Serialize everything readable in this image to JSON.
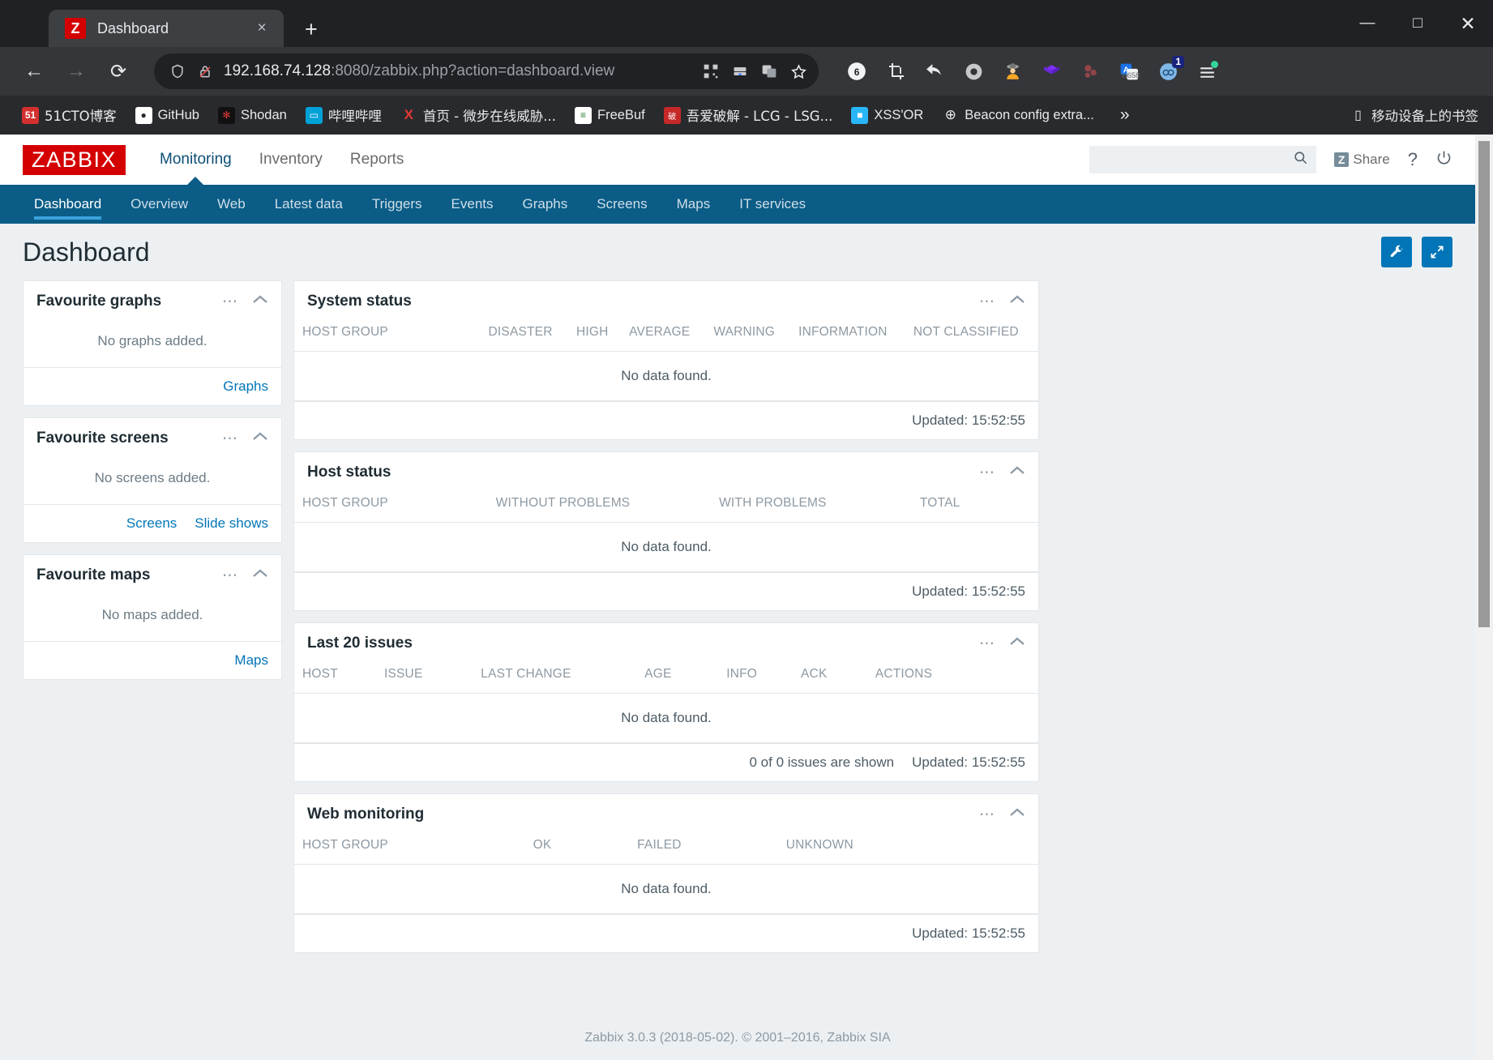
{
  "browser": {
    "tab": {
      "title": "Dashboard",
      "favicon_letter": "Z",
      "close_label": "×"
    },
    "new_tab_label": "+",
    "window_controls": {
      "minimize": "—",
      "maximize": "□",
      "close": "✕"
    },
    "nav": {
      "back": "←",
      "forward": "→",
      "reload": "⟳"
    },
    "omnibox": {
      "url_host": "192.168.74.128",
      "url_rest": ":8080/zabbix.php?action=dashboard.view",
      "shield_icon": "shield-icon",
      "lock_icon": "insecure-lock-icon",
      "qr_icon": "qr-code-icon",
      "device_icon": "save-to-device-icon",
      "translate_icon": "translate-icon",
      "bookmark_icon": "star-icon"
    },
    "extensions": [
      {
        "name": "counter-badge-icon",
        "glyph": "6"
      },
      {
        "name": "crop-capture-icon",
        "glyph": "⌧"
      },
      {
        "name": "undo-arrow-icon",
        "glyph": "↩"
      },
      {
        "name": "circle-ring-icon",
        "glyph": "◉"
      },
      {
        "name": "detective-icon",
        "glyph": "🕵"
      },
      {
        "name": "purple-cube-icon",
        "glyph": "⬟"
      },
      {
        "name": "red-dots-icon",
        "glyph": "⁙"
      },
      {
        "name": "translate-extension-icon",
        "glyph": "A"
      },
      {
        "name": "blue-badge-extension-icon",
        "glyph": "◑",
        "badge": "1"
      },
      {
        "name": "browser-menu-icon",
        "glyph": "≡"
      }
    ],
    "bookmarks": [
      {
        "label": "51CTO博客",
        "icon": "51cto-icon",
        "icon_text": "51",
        "icon_bg": "#d32f2f"
      },
      {
        "label": "GitHub",
        "icon": "github-icon",
        "icon_text": "●",
        "icon_bg": "#ffffff"
      },
      {
        "label": "Shodan",
        "icon": "shodan-icon",
        "icon_text": "⁙",
        "icon_bg": "#1a1a1a"
      },
      {
        "label": "哔哩哔哩",
        "icon": "bilibili-icon",
        "icon_text": "□",
        "icon_bg": "#00a1d6"
      },
      {
        "label": "首页 - 微步在线威胁...",
        "icon": "threatbook-icon",
        "icon_text": "X",
        "icon_bg": "transparent"
      },
      {
        "label": "FreeBuf",
        "icon": "freebuf-icon",
        "icon_text": "≡",
        "icon_bg": "#ffffff"
      },
      {
        "label": "吾爱破解 - LCG - LSG...",
        "icon": "52pojie-icon",
        "icon_text": "破",
        "icon_bg": "#c62828"
      },
      {
        "label": "XSS'OR",
        "icon": "xssor-icon",
        "icon_text": "■",
        "icon_bg": "#29b6f6"
      },
      {
        "label": "Beacon config extra...",
        "icon": "globe-icon",
        "icon_text": "⊕",
        "icon_bg": "transparent"
      }
    ],
    "bookmarks_overflow_label": "»",
    "mobile_bookmarks_label": "移动设备上的书签"
  },
  "zabbix": {
    "logo_text": "ZABBIX",
    "main_nav": [
      {
        "label": "Monitoring",
        "active": true
      },
      {
        "label": "Inventory",
        "active": false
      },
      {
        "label": "Reports",
        "active": false
      }
    ],
    "search": {
      "value": "",
      "placeholder": ""
    },
    "share_label": "Share",
    "share_badge": "Z",
    "help_label": "?",
    "logout_label": "⏻",
    "sub_nav": [
      {
        "label": "Dashboard",
        "active": true
      },
      {
        "label": "Overview",
        "active": false
      },
      {
        "label": "Web",
        "active": false
      },
      {
        "label": "Latest data",
        "active": false
      },
      {
        "label": "Triggers",
        "active": false
      },
      {
        "label": "Events",
        "active": false
      },
      {
        "label": "Graphs",
        "active": false
      },
      {
        "label": "Screens",
        "active": false
      },
      {
        "label": "Maps",
        "active": false
      },
      {
        "label": "IT services",
        "active": false
      }
    ],
    "page_title": "Dashboard",
    "page_actions": [
      {
        "name": "edit-dashboard-button",
        "icon": "wrench-icon"
      },
      {
        "name": "fullscreen-button",
        "icon": "expand-arrows-icon"
      }
    ],
    "favourite_graphs": {
      "title": "Favourite graphs",
      "empty": "No graphs added.",
      "links": [
        "Graphs"
      ]
    },
    "favourite_screens": {
      "title": "Favourite screens",
      "empty": "No screens added.",
      "links": [
        "Screens",
        "Slide shows"
      ]
    },
    "favourite_maps": {
      "title": "Favourite maps",
      "empty": "No maps added.",
      "links": [
        "Maps"
      ]
    },
    "system_status": {
      "title": "System status",
      "columns": [
        "Host group",
        "Disaster",
        "High",
        "Average",
        "Warning",
        "Information",
        "Not classified"
      ],
      "empty": "No data found.",
      "updated": "Updated: 15:52:55"
    },
    "host_status": {
      "title": "Host status",
      "columns": [
        "Host group",
        "Without problems",
        "With problems",
        "Total"
      ],
      "empty": "No data found.",
      "updated": "Updated: 15:52:55"
    },
    "last_issues": {
      "title": "Last 20 issues",
      "columns": [
        "Host",
        "Issue",
        "Last change",
        "Age",
        "Info",
        "Ack",
        "Actions"
      ],
      "empty": "No data found.",
      "shown": "0 of 0 issues are shown",
      "updated": "Updated: 15:52:55"
    },
    "web_monitoring": {
      "title": "Web monitoring",
      "columns": [
        "Host group",
        "Ok",
        "Failed",
        "Unknown"
      ],
      "empty": "No data found.",
      "updated": "Updated: 15:52:55"
    },
    "footer": "Zabbix 3.0.3 (2018-05-02). © 2001–2016, Zabbix SIA",
    "colors": {
      "brand_red": "#d40000",
      "nav_blue": "#0b5c87",
      "accent_blue": "#0275b8",
      "link_blue": "#0275b8"
    }
  }
}
